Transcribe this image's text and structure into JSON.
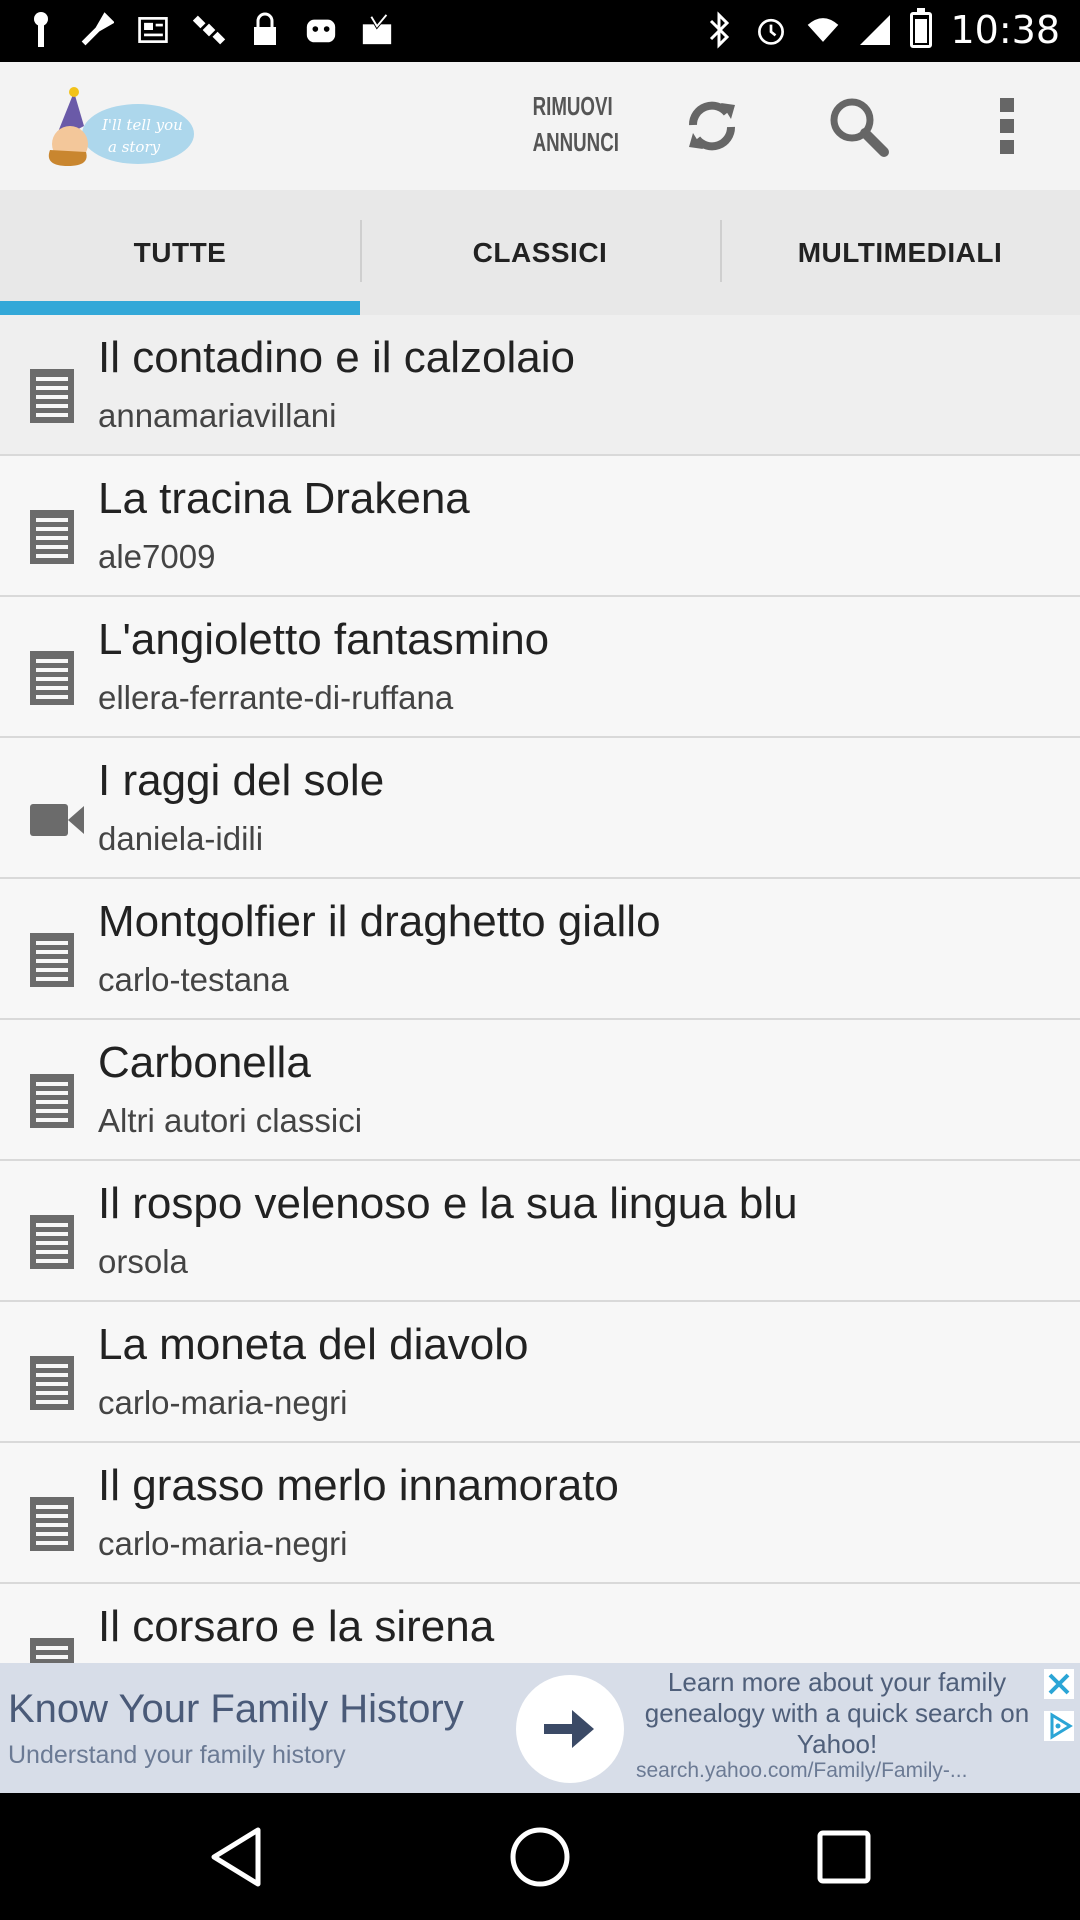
{
  "status_bar": {
    "time": "10:38",
    "left_icons": [
      "notification-icon",
      "wrench-icon",
      "news-icon",
      "satellite-icon",
      "lock-icon",
      "android-icon",
      "download-icon"
    ],
    "right_icons": [
      "bluetooth-icon",
      "alarm-icon",
      "wifi-icon",
      "signal-icon",
      "battery-icon"
    ]
  },
  "app_bar": {
    "logo_text": "I'll tell you a story",
    "remove_ads_line1": "RIMUOVI",
    "remove_ads_line2": "ANNUNCI"
  },
  "tabs": [
    {
      "label": "TUTTE",
      "active": true
    },
    {
      "label": "CLASSICI",
      "active": false
    },
    {
      "label": "MULTIMEDIALI",
      "active": false
    }
  ],
  "stories": [
    {
      "title": "Il contadino e il calzolaio",
      "author": "annamariavillani",
      "type": "text"
    },
    {
      "title": "La tracina Drakena",
      "author": "ale7009",
      "type": "text"
    },
    {
      "title": "L'angioletto fantasmino",
      "author": "ellera-ferrante-di-ruffana",
      "type": "text"
    },
    {
      "title": "I raggi del sole",
      "author": "daniela-idili",
      "type": "video"
    },
    {
      "title": "Montgolfier il draghetto giallo",
      "author": "carlo-testana",
      "type": "text"
    },
    {
      "title": "Carbonella",
      "author": "Altri autori classici",
      "type": "text"
    },
    {
      "title": "Il rospo velenoso e la sua lingua blu",
      "author": "orsola",
      "type": "text"
    },
    {
      "title": "La moneta del diavolo",
      "author": "carlo-maria-negri",
      "type": "text"
    },
    {
      "title": "Il grasso merlo innamorato",
      "author": "carlo-maria-negri",
      "type": "text"
    },
    {
      "title": "Il corsaro e la sirena",
      "author": "",
      "type": "text"
    }
  ],
  "ad": {
    "headline": "Know Your Family History",
    "subline": "Understand your family history",
    "description": "Learn more about your family genealogy with a quick search on Yahoo!",
    "url": "search.yahoo.com/Family/Family-..."
  },
  "colors": {
    "accent": "#33a8d8",
    "tab_background": "#e8e8e8",
    "list_background": "#f7f7f7",
    "ad_background": "#d7dde8"
  }
}
